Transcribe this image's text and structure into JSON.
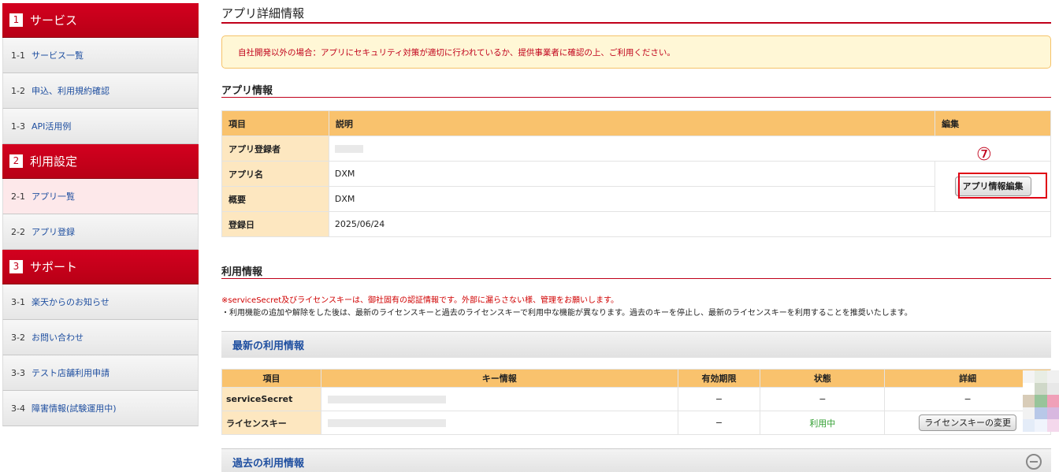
{
  "sidebar": {
    "sections": [
      {
        "num": "1",
        "title": "サービス",
        "items": [
          {
            "num": "1-1",
            "label": "サービス一覧"
          },
          {
            "num": "1-2",
            "label": "申込、利用規約確認"
          },
          {
            "num": "1-3",
            "label": "API活用例"
          }
        ]
      },
      {
        "num": "2",
        "title": "利用設定",
        "items": [
          {
            "num": "2-1",
            "label": "アプリ一覧"
          },
          {
            "num": "2-2",
            "label": "アプリ登録"
          }
        ]
      },
      {
        "num": "3",
        "title": "サポート",
        "items": [
          {
            "num": "3-1",
            "label": "楽天からのお知らせ"
          },
          {
            "num": "3-2",
            "label": "お問い合わせ"
          },
          {
            "num": "3-3",
            "label": "テスト店舗利用申請"
          },
          {
            "num": "3-4",
            "label": "障害情報(試験運用中)"
          }
        ]
      }
    ]
  },
  "page": {
    "title": "アプリ詳細情報",
    "notice": "自社開発以外の場合：アプリにセキュリティ対策が適切に行われているか、提供事業者に確認の上、ご利用ください。"
  },
  "app_info": {
    "heading": "アプリ情報",
    "headers": {
      "item": "項目",
      "desc": "説明",
      "edit": "編集"
    },
    "rows": {
      "registrant_label": "アプリ登録者",
      "name_label": "アプリ名",
      "name_value": "DXM",
      "summary_label": "概要",
      "summary_value": "DXM",
      "date_label": "登録日",
      "date_value": "2025/06/24"
    },
    "edit_button": "アプリ情報編集",
    "step_marker": "⑦"
  },
  "usage_info": {
    "heading": "利用情報",
    "red_note": "※serviceSecret及びライセンスキーは、御社固有の認証情報です。外部に漏らさない様、管理をお願いします。",
    "note": "・利用機能の追加や解除をした後は、最新のライセンスキーと過去のライセンスキーで利用中な機能が異なります。過去のキーを停止し、最新のライセンスキーを利用することを推奨いたします。",
    "latest_bar": "最新の利用情報",
    "past_bar": "過去の利用情報",
    "headers": {
      "item": "項目",
      "key": "キー情報",
      "expiry": "有効期限",
      "status": "状態",
      "detail": "詳細"
    },
    "rows": {
      "secret_label": "serviceSecret",
      "secret_expiry": "−",
      "secret_status": "−",
      "secret_detail": "−",
      "license_label": "ライセンスキー",
      "license_expiry": "−",
      "license_status": "利用中",
      "license_button": "ライセンスキーの変更"
    }
  },
  "colors": {
    "brand_red": "#c0001a",
    "table_header": "#f9c26d",
    "status_green": "#2f9e2f"
  }
}
